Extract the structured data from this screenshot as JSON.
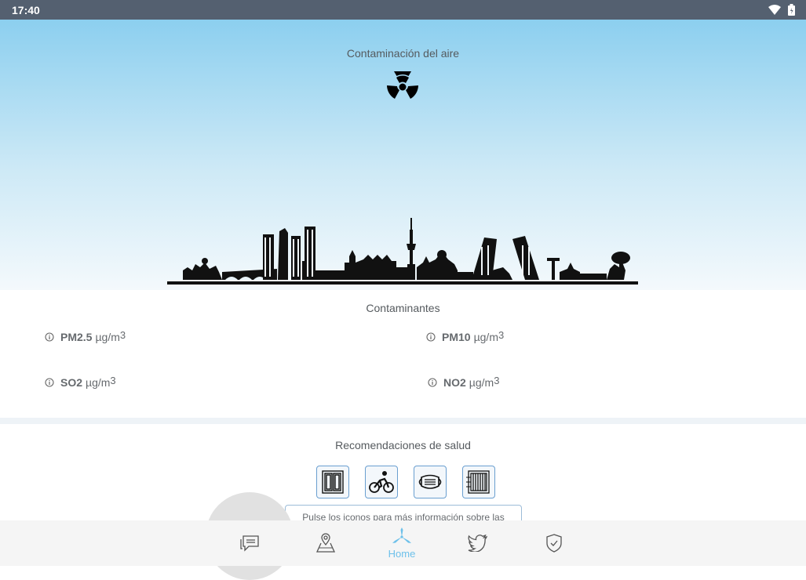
{
  "status_bar": {
    "time": "17:40",
    "icons": [
      "wifi-icon",
      "battery-icon"
    ]
  },
  "hero": {
    "title": "Contaminación del aire",
    "icon": "radiation-icon",
    "illustration": "madrid-skyline"
  },
  "pollutants": {
    "title": "Contaminantes",
    "unit": "µg/m",
    "unit_power": "3",
    "items": [
      {
        "name": "PM2.5"
      },
      {
        "name": "PM10"
      },
      {
        "name": "SO2"
      },
      {
        "name": "NO2"
      }
    ]
  },
  "health": {
    "title": "Recomendaciones de salud",
    "icons": [
      "window-icon",
      "cycling-icon",
      "mask-icon",
      "air-purifier-icon"
    ],
    "hint": "Pulse los iconos para más información sobre las"
  },
  "nav": {
    "items": [
      {
        "icon": "chat-icon",
        "label": ""
      },
      {
        "icon": "map-location-icon",
        "label": ""
      },
      {
        "icon": "windmill-icon",
        "label": "Home",
        "active": true
      },
      {
        "icon": "twitter-icon",
        "label": ""
      },
      {
        "icon": "shield-check-icon",
        "label": ""
      }
    ]
  },
  "colors": {
    "status_bar": "#546070",
    "sky_top": "#8ccfef",
    "accent": "#6cc0ea",
    "icon_border": "#6a9fd0"
  }
}
